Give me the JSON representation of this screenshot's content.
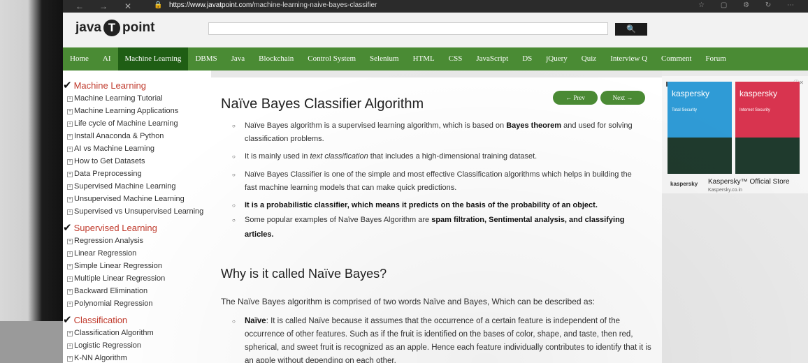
{
  "browser": {
    "url_host": "https://www.javatpoint.com",
    "url_path": "/machine-learning-naive-bayes-classifier",
    "back_icon": "arrow-left",
    "forward_icon": "arrow-right",
    "close_icon": "x"
  },
  "header": {
    "logo_left": "java",
    "logo_mark": "T",
    "logo_right": "point",
    "search_placeholder": "",
    "search_icon": "magnifier"
  },
  "menu": {
    "items": [
      "Home",
      "AI",
      "Machine Learning",
      "DBMS",
      "Java",
      "Blockchain",
      "Control System",
      "Selenium",
      "HTML",
      "CSS",
      "JavaScript",
      "DS",
      "jQuery",
      "Quiz",
      "Interview Q",
      "Comment",
      "Forum"
    ],
    "active": "Machine Learning"
  },
  "sidebar": {
    "sections": [
      {
        "title": "Machine Learning",
        "items": [
          "Machine Learning Tutorial",
          "Machine Learning Applications",
          "Life cycle of Machine Learning",
          "Install Anaconda & Python",
          "AI vs Machine Learning",
          "How to Get Datasets",
          "Data Preprocessing",
          "Supervised Machine Learning",
          "Unsupervised Machine Learning",
          "Supervised vs Unsupervised Learning"
        ]
      },
      {
        "title": "Supervised Learning",
        "items": [
          "Regression Analysis",
          "Linear Regression",
          "Simple Linear Regression",
          "Multiple Linear Regression",
          "Backward Elimination",
          "Polynomial Regression"
        ]
      },
      {
        "title": "Classification",
        "items": [
          "Classification Algorithm",
          "Logistic Regression",
          "K-NN Algorithm"
        ]
      }
    ]
  },
  "content": {
    "title": "Naïve Bayes Classifier Algorithm",
    "prev_label": "← Prev",
    "next_label": "Next →",
    "bullets": [
      {
        "l1a": "Naïve Bayes algorithm is a supervised learning algorithm, which is based on ",
        "l1b": "Bayes theorem",
        "l1c": " and used for solving",
        "l2": "classification problems."
      },
      {
        "l1a": "It is mainly used in ",
        "l1b": "text classification",
        "l1c": " that includes a high-dimensional training dataset."
      },
      {
        "l1a": "Naïve Bayes Classifier is one of the simple and most effective Classification algorithms which helps in building the",
        "l2": "fast machine learning models that can make quick predictions."
      },
      {
        "l1a": "It is a probabilistic classifier, which means it predicts on the basis of the probability of an object."
      },
      {
        "l1a": "Some popular examples of Naïve Bayes Algorithm are ",
        "l1b": "spam filtration, Sentimental analysis, and classifying",
        "l2": "articles."
      }
    ],
    "subtitle": "Why is it called Naïve Bayes?",
    "para": "The Naïve Bayes algorithm is comprised of two words Naïve and Bayes, Which can be described as:",
    "naive_term": "Naïve",
    "naive_lines": [
      ": It is called Naïve because it assumes that the occurrence of a certain feature is independent of the",
      "occurrence of other features. Such as if the fruit is identified on the bases of color, shape, and taste, then red,",
      "spherical, and sweet fruit is recognized as an apple. Hence each feature individually contributes to identify that it is",
      "an apple without depending on each other."
    ]
  },
  "ad": {
    "tag": "AD",
    "close": "ⓘ✕",
    "box1_brand": "kaspersky",
    "box1_sub": "Total Security",
    "box2_brand": "kaspersky",
    "box2_sub": "Internet Security",
    "brand": "kaspersky",
    "store": "Kaspersky™ Official Store",
    "site": "Kaspersky.co.in"
  },
  "colors": {
    "menu_green": "#4a8b34",
    "menu_active": "#1f5e14",
    "sidebar_heading": "#c0392b",
    "box1": "#2f9bd6",
    "box2": "#d8344f"
  }
}
